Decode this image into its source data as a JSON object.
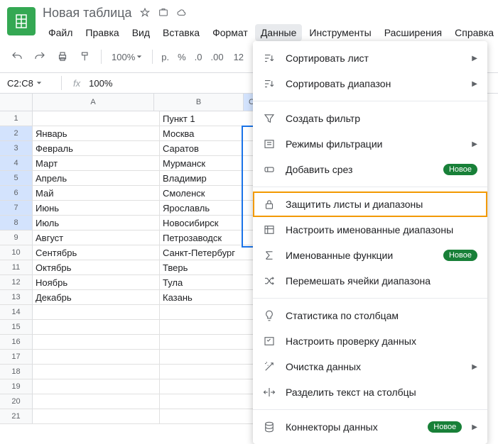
{
  "header": {
    "title": "Новая таблица",
    "menubar": [
      "Файл",
      "Правка",
      "Вид",
      "Вставка",
      "Формат",
      "Данные",
      "Инструменты",
      "Расширения",
      "Справка"
    ],
    "active_menu_index": 5
  },
  "toolbar": {
    "zoom": "100%",
    "currency": "р.",
    "percent": "%",
    "dec_less": ".0",
    "dec_more": ".00",
    "format_num": "12"
  },
  "namebox": {
    "ref": "C2:C8",
    "formula": "100%"
  },
  "columns": [
    "A",
    "B",
    "C"
  ],
  "rows": [
    {
      "n": 1,
      "a": "",
      "b": "Пункт 1",
      "c": "П",
      "sel": false
    },
    {
      "n": 2,
      "a": "Январь",
      "b": "Москва",
      "c": "",
      "sel": true
    },
    {
      "n": 3,
      "a": "Февраль",
      "b": "Саратов",
      "c": "",
      "sel": true
    },
    {
      "n": 4,
      "a": "Март",
      "b": "Мурманск",
      "c": "",
      "sel": true
    },
    {
      "n": 5,
      "a": "Апрель",
      "b": "Владимир",
      "c": "",
      "sel": true
    },
    {
      "n": 6,
      "a": "Май",
      "b": "Смоленск",
      "c": "",
      "sel": true
    },
    {
      "n": 7,
      "a": "Июнь",
      "b": "Ярославль",
      "c": "",
      "sel": true
    },
    {
      "n": 8,
      "a": "Июль",
      "b": "Новосибирск",
      "c": "",
      "sel": true
    },
    {
      "n": 9,
      "a": "Август",
      "b": "Петрозаводск",
      "c": "",
      "sel": false
    },
    {
      "n": 10,
      "a": "Сентябрь",
      "b": "Санкт-Петербург",
      "c": "",
      "sel": false
    },
    {
      "n": 11,
      "a": "Октябрь",
      "b": "Тверь",
      "c": "",
      "sel": false
    },
    {
      "n": 12,
      "a": "Ноябрь",
      "b": "Тула",
      "c": "",
      "sel": false
    },
    {
      "n": 13,
      "a": "Декабрь",
      "b": "Казань",
      "c": "",
      "sel": false
    },
    {
      "n": 14,
      "a": "",
      "b": "",
      "c": "",
      "sel": false
    },
    {
      "n": 15,
      "a": "",
      "b": "",
      "c": "",
      "sel": false
    },
    {
      "n": 16,
      "a": "",
      "b": "",
      "c": "",
      "sel": false
    },
    {
      "n": 17,
      "a": "",
      "b": "",
      "c": "",
      "sel": false
    },
    {
      "n": 18,
      "a": "",
      "b": "",
      "c": "",
      "sel": false
    },
    {
      "n": 19,
      "a": "",
      "b": "",
      "c": "",
      "sel": false
    },
    {
      "n": 20,
      "a": "",
      "b": "",
      "c": "",
      "sel": false
    },
    {
      "n": 21,
      "a": "",
      "b": "",
      "c": "",
      "sel": false
    }
  ],
  "dropdown": {
    "items": [
      {
        "icon": "sort",
        "label": "Сортировать лист",
        "arrow": true
      },
      {
        "icon": "sort",
        "label": "Сортировать диапазон",
        "arrow": true
      },
      {
        "sep": true
      },
      {
        "icon": "filter",
        "label": "Создать фильтр"
      },
      {
        "icon": "filter-views",
        "label": "Режимы фильтрации",
        "arrow": true
      },
      {
        "icon": "slicer",
        "label": "Добавить срез",
        "badge": "Новое"
      },
      {
        "sep": true
      },
      {
        "icon": "lock",
        "label": "Защитить листы и диапазоны",
        "highlight": true
      },
      {
        "icon": "named-range",
        "label": "Настроить именованные диапазоны"
      },
      {
        "icon": "sigma",
        "label": "Именованные функции",
        "badge": "Новое"
      },
      {
        "icon": "shuffle",
        "label": "Перемешать ячейки диапазона"
      },
      {
        "sep": true
      },
      {
        "icon": "bulb",
        "label": "Статистика по столбцам"
      },
      {
        "icon": "checklist",
        "label": "Настроить проверку данных"
      },
      {
        "icon": "wand",
        "label": "Очистка данных",
        "arrow": true
      },
      {
        "icon": "split",
        "label": "Разделить текст на столбцы"
      },
      {
        "sep": true
      },
      {
        "icon": "database",
        "label": "Коннекторы данных",
        "badge": "Новое",
        "arrow": true
      }
    ]
  }
}
